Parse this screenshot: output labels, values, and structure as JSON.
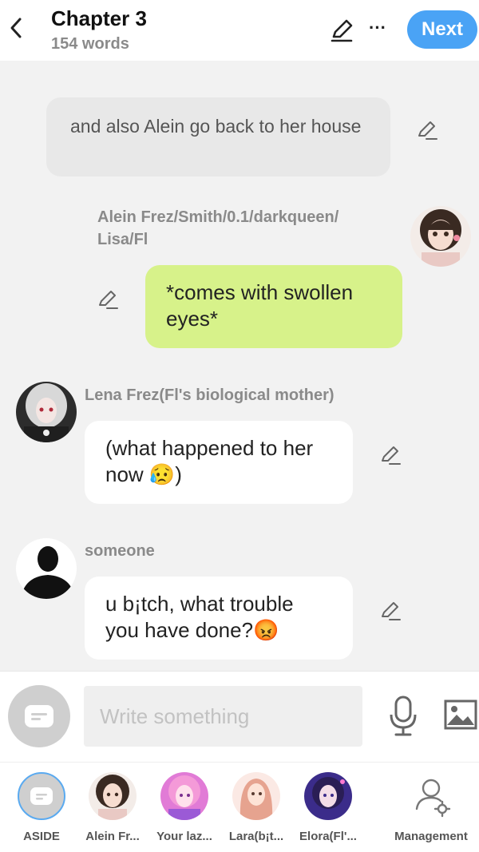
{
  "header": {
    "title": "Chapter 3",
    "word_count": "154 words",
    "next_label": "Next"
  },
  "messages": [
    {
      "type": "aside",
      "text": "and also Alein go back to her house"
    },
    {
      "type": "right",
      "speaker": "Alein Frez/Smith/0.1/darkqueen/ Lisa/Fl",
      "text": "*comes with swollen eyes*"
    },
    {
      "type": "left",
      "speaker": "Lena Frez(Fl's biological mother)",
      "text": "(what happened to her now 😥)"
    },
    {
      "type": "left",
      "speaker": "someone",
      "text": "u b¡tch, what trouble you have done?😡"
    }
  ],
  "composer": {
    "placeholder": "Write something"
  },
  "characters": [
    {
      "label": "ASIDE"
    },
    {
      "label": "Alein Fr..."
    },
    {
      "label": "Your laz..."
    },
    {
      "label": "Lara(b¡t..."
    },
    {
      "label": "Elora(Fl'..."
    },
    {
      "label": "Management"
    }
  ],
  "colors": {
    "accent": "#4aa3f5",
    "right_bubble": "#d7f28a",
    "aside_bubble": "#e8e8e8",
    "background": "#f2f2f2"
  }
}
